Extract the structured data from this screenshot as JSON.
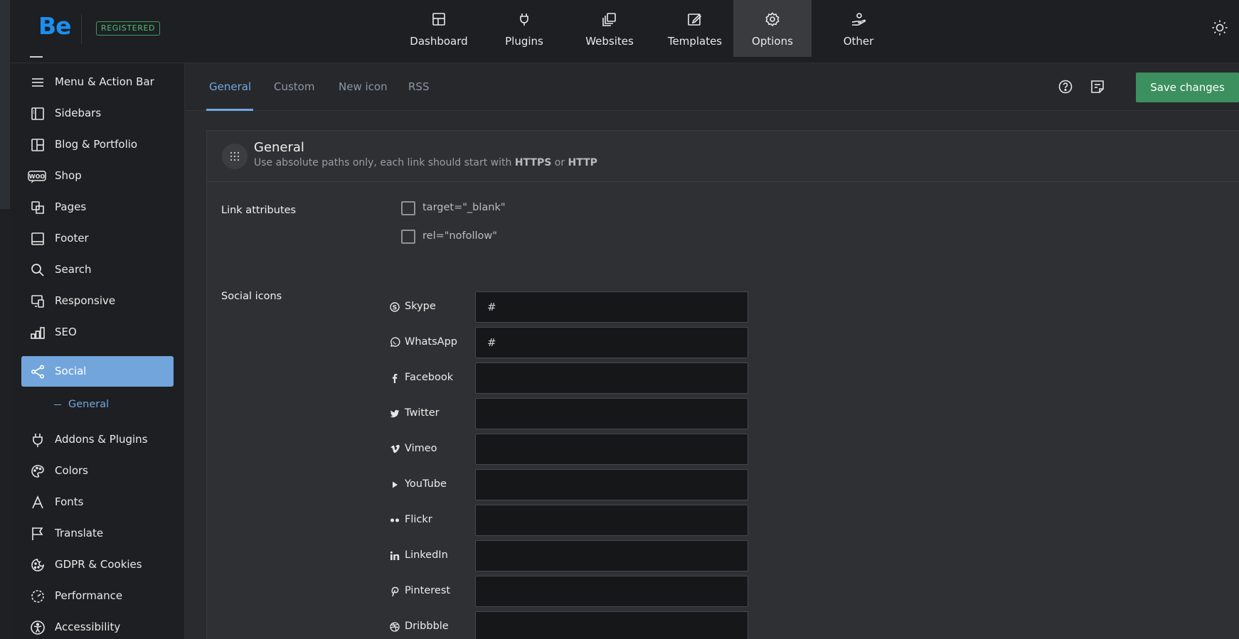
{
  "header": {
    "logo": "Be",
    "badge": "REGISTERED",
    "nav": [
      {
        "label": "Dashboard",
        "icon": "dashboard-icon"
      },
      {
        "label": "Plugins",
        "icon": "plug-icon"
      },
      {
        "label": "Websites",
        "icon": "websites-icon"
      },
      {
        "label": "Templates",
        "icon": "templates-icon"
      },
      {
        "label": "Options",
        "icon": "gear-icon",
        "active": true
      },
      {
        "label": "Other",
        "icon": "hand-user-icon"
      }
    ],
    "theme_toggle_icon": "sun-icon"
  },
  "sidebar": {
    "items": [
      {
        "label": "Menu & Action Bar",
        "icon": "menu-icon"
      },
      {
        "label": "Sidebars",
        "icon": "sidebar-icon"
      },
      {
        "label": "Blog & Portfolio",
        "icon": "layout-icon"
      },
      {
        "label": "Shop",
        "icon": "woo-icon"
      },
      {
        "label": "Pages",
        "icon": "pages-icon"
      },
      {
        "label": "Footer",
        "icon": "footer-icon"
      },
      {
        "label": "Search",
        "icon": "search-icon"
      },
      {
        "label": "Responsive",
        "icon": "responsive-icon"
      },
      {
        "label": "SEO",
        "icon": "seo-icon"
      },
      {
        "label": "Social",
        "icon": "share-icon",
        "active": true
      },
      {
        "label": "Addons & Plugins",
        "icon": "plug-icon"
      },
      {
        "label": "Colors",
        "icon": "palette-icon"
      },
      {
        "label": "Fonts",
        "icon": "font-icon"
      },
      {
        "label": "Translate",
        "icon": "flag-icon"
      },
      {
        "label": "GDPR & Cookies",
        "icon": "cookie-icon"
      },
      {
        "label": "Performance",
        "icon": "performance-icon"
      },
      {
        "label": "Accessibility",
        "icon": "accessibility-icon"
      }
    ],
    "sub_item": "General"
  },
  "tabs": {
    "items": [
      "General",
      "Custom",
      "New icon",
      "RSS"
    ],
    "active": "General",
    "save_label": "Save changes"
  },
  "panel": {
    "title": "General",
    "desc_prefix": "Use absolute paths only, each link should start with",
    "desc_https": "HTTPS",
    "desc_or": "or",
    "desc_http": "HTTP",
    "link_attributes_label": "Link attributes",
    "checkboxes": [
      {
        "label": "target=\"_blank\"",
        "checked": false
      },
      {
        "label": "rel=\"nofollow\"",
        "checked": false
      }
    ],
    "social_icons_label": "Social icons",
    "social": [
      {
        "label": "Skype",
        "value": "#",
        "icon": "skype-icon"
      },
      {
        "label": "WhatsApp",
        "value": "#",
        "icon": "whatsapp-icon"
      },
      {
        "label": "Facebook",
        "value": "",
        "icon": "facebook-icon"
      },
      {
        "label": "Twitter",
        "value": "",
        "icon": "twitter-icon"
      },
      {
        "label": "Vimeo",
        "value": "",
        "icon": "vimeo-icon"
      },
      {
        "label": "YouTube",
        "value": "",
        "icon": "youtube-icon"
      },
      {
        "label": "Flickr",
        "value": "",
        "icon": "flickr-icon"
      },
      {
        "label": "LinkedIn",
        "value": "",
        "icon": "linkedin-icon"
      },
      {
        "label": "Pinterest",
        "value": "",
        "icon": "pinterest-icon"
      },
      {
        "label": "Dribbble",
        "value": "",
        "icon": "dribbble-icon"
      }
    ]
  },
  "colors": {
    "accent_blue": "#6fa8e3",
    "save_green": "#3c8f5e",
    "active_sidebar": "#72a5dc"
  }
}
